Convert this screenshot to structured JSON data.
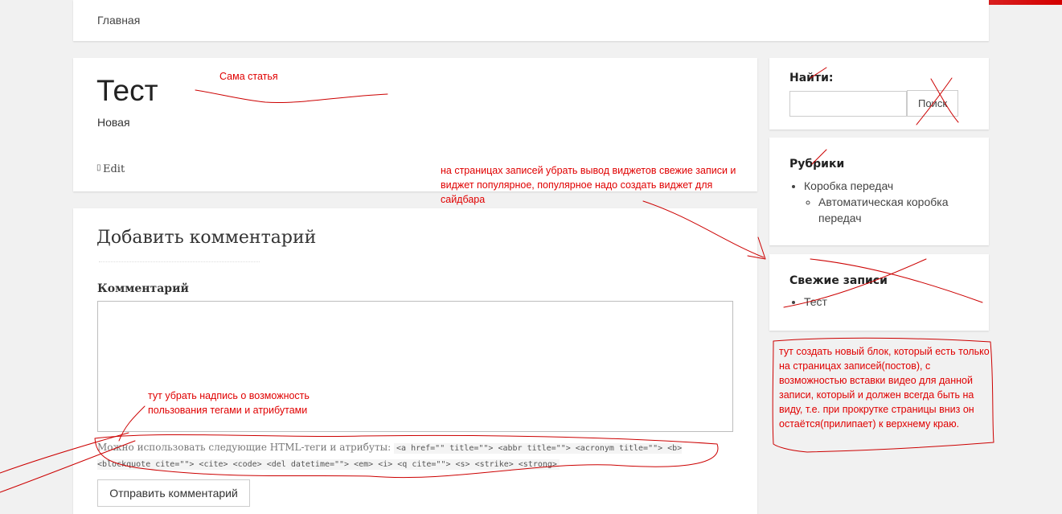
{
  "nav": {
    "home_label": "Главная"
  },
  "post": {
    "title": "Тест",
    "category": "Новая",
    "edit_label": "Edit"
  },
  "comments": {
    "reply_title": "Добавить комментарий",
    "comment_label": "Комментарий",
    "allowed_tags_text": "Можно использовать следующие HTML-теги и атрибуты:",
    "allowed_tags_code": "<a href=\"\" title=\"\"> <abbr title=\"\"> <acronym title=\"\"> <b> <blockquote cite=\"\"> <cite> <code> <del datetime=\"\"> <em> <i> <q cite=\"\"> <s> <strike> <strong>",
    "submit_label": "Отправить комментарий"
  },
  "sidebar": {
    "search": {
      "title": "Найти:",
      "button_label": "Поиск",
      "input_value": ""
    },
    "categories": {
      "title": "Рубрики",
      "items": [
        {
          "label": "Коробка передач",
          "children": [
            {
              "label": "Автоматическая коробка передач"
            }
          ]
        }
      ]
    },
    "recent": {
      "title": "Свежие записи",
      "items": [
        {
          "label": "Тест"
        }
      ]
    }
  },
  "annotations": {
    "article": "Сама статья",
    "widgets": "на страницах записей убрать вывод виджетов свежие записи и виджет популярное, популярное надо создать виджет для сайдбара",
    "tags": "тут убрать надпись о возможность пользования тегами и атрибутами",
    "new_block": "тут создать новый блок, который есть только на страницах записей(постов), с возможностью вставки видео для данной записи, который и должен всегда быть на виду, т.е. при прокрутке страницы вниз он остаётся(прилипает) к верхнему краю."
  },
  "colors": {
    "annotation": "#e00000",
    "background": "#f1f1f1",
    "card": "#ffffff"
  }
}
